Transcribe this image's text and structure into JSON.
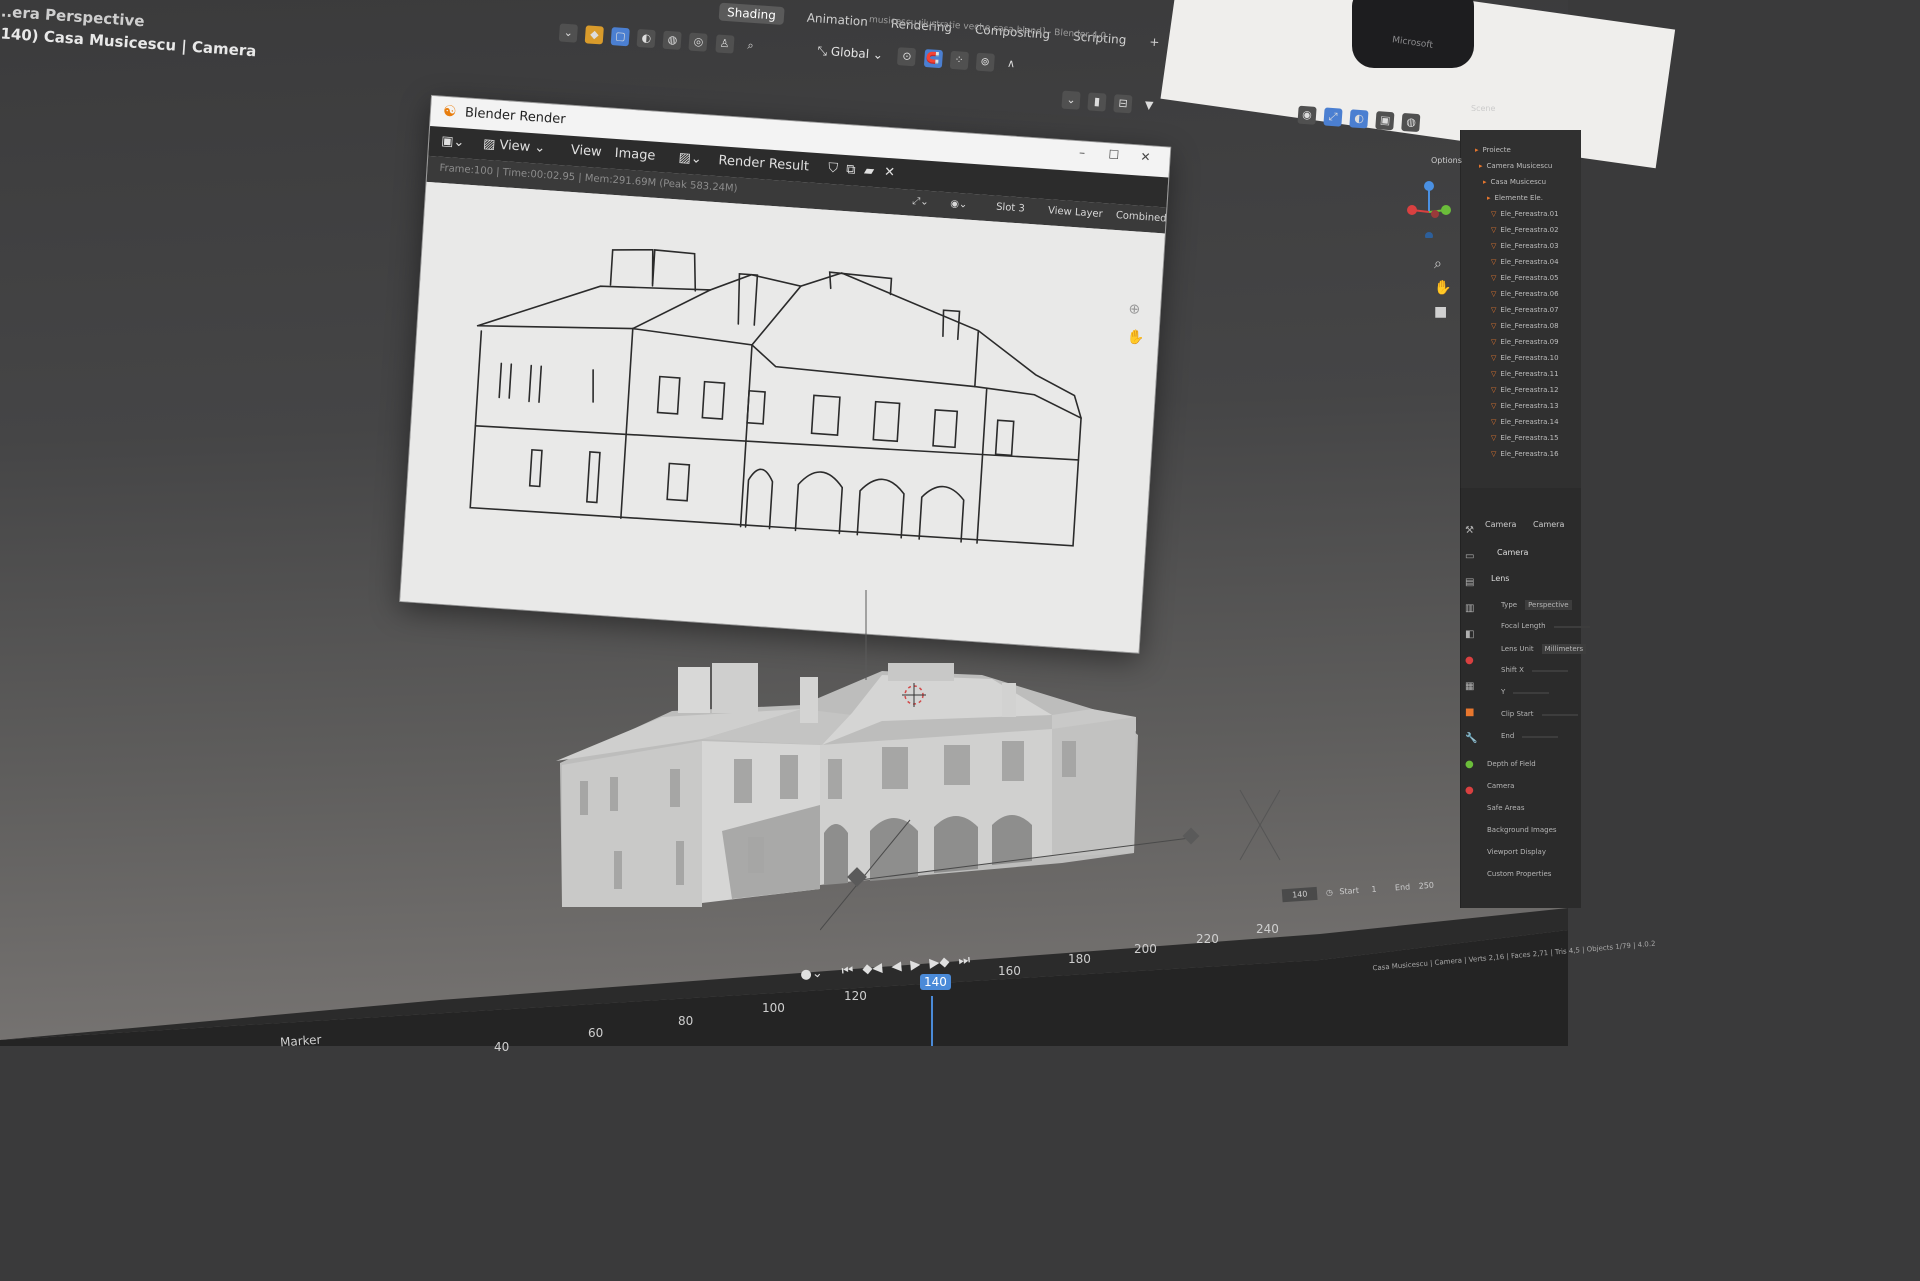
{
  "viewport_label": {
    "line1": "...era Perspective",
    "line2": "(140) Casa Musicescu | Camera"
  },
  "workspace_tabs": [
    "Shading",
    "Animation",
    "Rendering",
    "Compositing",
    "Scripting",
    "+"
  ],
  "window_title_fragment": "musicescu_ilustratie veche casa.blend] - Blender 4.0",
  "toolbar": {
    "transform_orientation": "Global"
  },
  "render_window": {
    "title": "Blender Render",
    "menu": [
      "View",
      "View",
      "Image"
    ],
    "result_label": "Render Result",
    "slot": "Slot 3",
    "view_layer": "View Layer",
    "pass": "Combined",
    "status": "Frame:100 | Time:00:02.95 | Mem:291.69M (Peak 583.24M)",
    "controls": [
      "–",
      "☐",
      "✕"
    ]
  },
  "webcam": {
    "brand": "Microsoft"
  },
  "outliner": {
    "header": "Scene",
    "options": "Options",
    "rows": [
      "Proiecte",
      "Camera Musicescu",
      "Casa Musicescu",
      "Elemente Ele.",
      "Ele_Fereastra.01",
      "Ele_Fereastra.02",
      "Ele_Fereastra.03",
      "Ele_Fereastra.04",
      "Ele_Fereastra.05",
      "Ele_Fereastra.06",
      "Ele_Fereastra.07",
      "Ele_Fereastra.08",
      "Ele_Fereastra.09",
      "Ele_Fereastra.10",
      "Ele_Fereastra.11",
      "Ele_Fereastra.12",
      "Ele_Fereastra.13",
      "Ele_Fereastra.14",
      "Ele_Fereastra.15",
      "Ele_Fereastra.16"
    ]
  },
  "properties": {
    "tabs": [
      "Camera",
      "Camera"
    ],
    "object": "Camera",
    "section": "Lens",
    "rows": [
      {
        "label": "Type",
        "value": "Perspective"
      },
      {
        "label": "Focal Length",
        "value": ""
      },
      {
        "label": "Lens Unit",
        "value": "Millimeters"
      },
      {
        "label": "Shift X",
        "value": ""
      },
      {
        "label": "Y",
        "value": ""
      },
      {
        "label": "Clip Start",
        "value": ""
      },
      {
        "label": "End",
        "value": ""
      }
    ],
    "panels": [
      "Depth of Field",
      "Camera",
      "Safe Areas",
      "Background Images",
      "Viewport Display",
      "Custom Properties"
    ]
  },
  "timeline": {
    "marker_label": "Marker",
    "current_frame": "140",
    "ticks": [
      "40",
      "60",
      "80",
      "100",
      "120",
      "160",
      "180",
      "200",
      "220",
      "240"
    ],
    "frame_field": "140",
    "start_label": "Start",
    "start_value": "1",
    "end_label": "End",
    "end_value": "250"
  },
  "status_bar": "Casa Musicescu | Camera | Verts 2,16 | Faces 2,71 | Tris 4,5 | Objects 1/79 | 4.0.2"
}
